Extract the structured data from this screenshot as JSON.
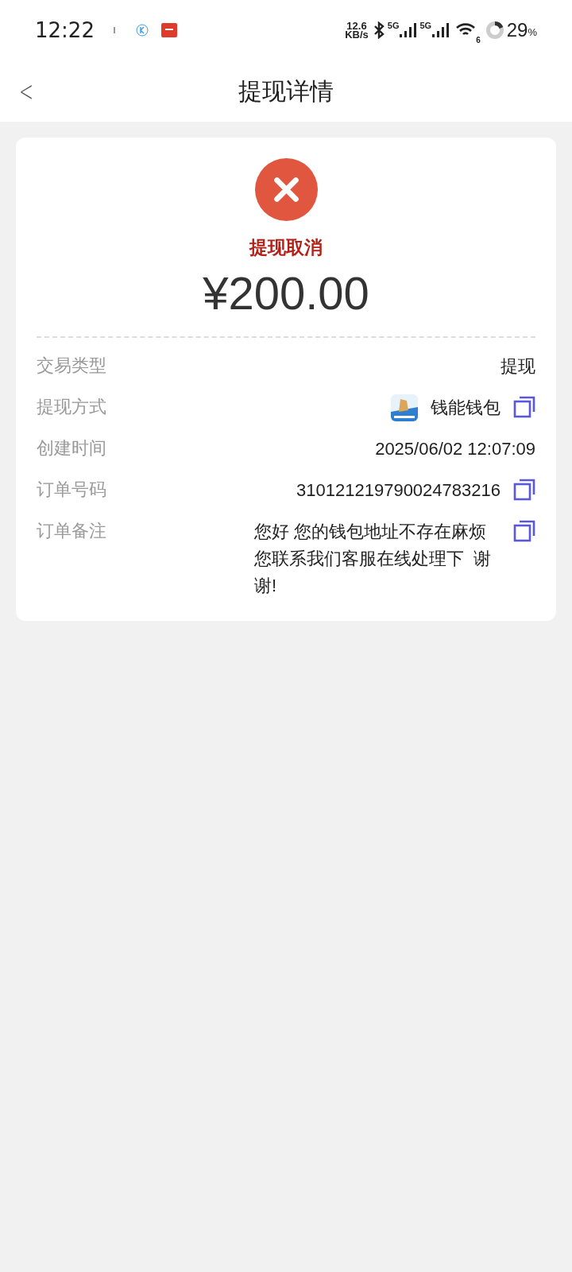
{
  "status_bar": {
    "time": "12:22",
    "net_speed": "12.6",
    "net_unit": "KB/s",
    "signal_1": "5G",
    "signal_2": "5G",
    "wifi_badge": "6",
    "battery": "29",
    "battery_unit": "%"
  },
  "header": {
    "back": "<",
    "title": "提现详情"
  },
  "card": {
    "status": "提现取消",
    "amount": "¥200.00",
    "rows": [
      {
        "label": "交易类型",
        "value": "提现",
        "app_icon": false,
        "copy": false
      },
      {
        "label": "提现方式",
        "value": "钱能钱包",
        "app_icon": true,
        "copy": true
      },
      {
        "label": "创建时间",
        "value": "2025/06/02 12:07:09",
        "app_icon": false,
        "copy": false
      },
      {
        "label": "订单号码",
        "value": "310121219790024783216",
        "app_icon": false,
        "copy": true
      },
      {
        "label": "订单备注",
        "value": "您好 您的钱包地址不存在麻烦您联系我们客服在线处理下  谢谢!",
        "app_icon": false,
        "copy": true
      }
    ]
  }
}
